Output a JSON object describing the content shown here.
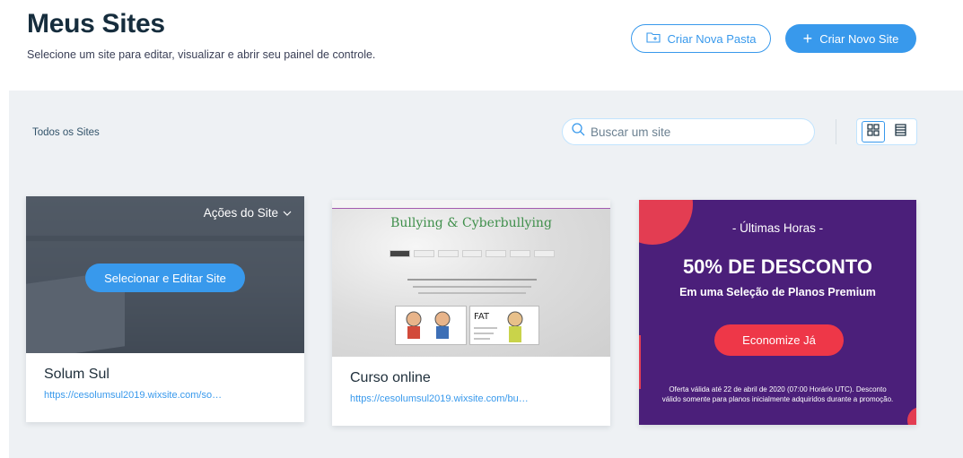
{
  "header": {
    "title": "Meus Sites",
    "subtitle": "Selecione um site para editar, visualizar e abrir seu painel de controle.",
    "create_folder_label": "Criar Nova Pasta",
    "create_site_label": "Criar Novo Site"
  },
  "toolbar": {
    "filter_label": "Todos os Sites",
    "search_placeholder": "Buscar um site",
    "view_mode": "grid"
  },
  "sites": [
    {
      "name": "Solum Sul",
      "url": "https://cesolumsul2019.wixsite.com/so…",
      "actions_label": "Ações do Site",
      "select_label": "Selecionar e Editar Site"
    },
    {
      "name": "Curso online",
      "url": "https://cesolumsul2019.wixsite.com/bu…",
      "thumbnail_title": "Bullying & Cyberbullying"
    }
  ],
  "promo": {
    "eyebrow": "- Últimas Horas -",
    "headline": "50% DE DESCONTO",
    "subheadline": "Em uma Seleção de Planos Premium",
    "cta_label": "Economize Já",
    "fine_print": "Oferta válida até 22 de abril de 2020 (07:00 Horário UTC). Desconto válido somente para planos inicialmente adquiridos durante a promoção."
  },
  "colors": {
    "accent": "#3899ec",
    "promo_bg": "#4b1f7a",
    "promo_red": "#e33d52"
  }
}
